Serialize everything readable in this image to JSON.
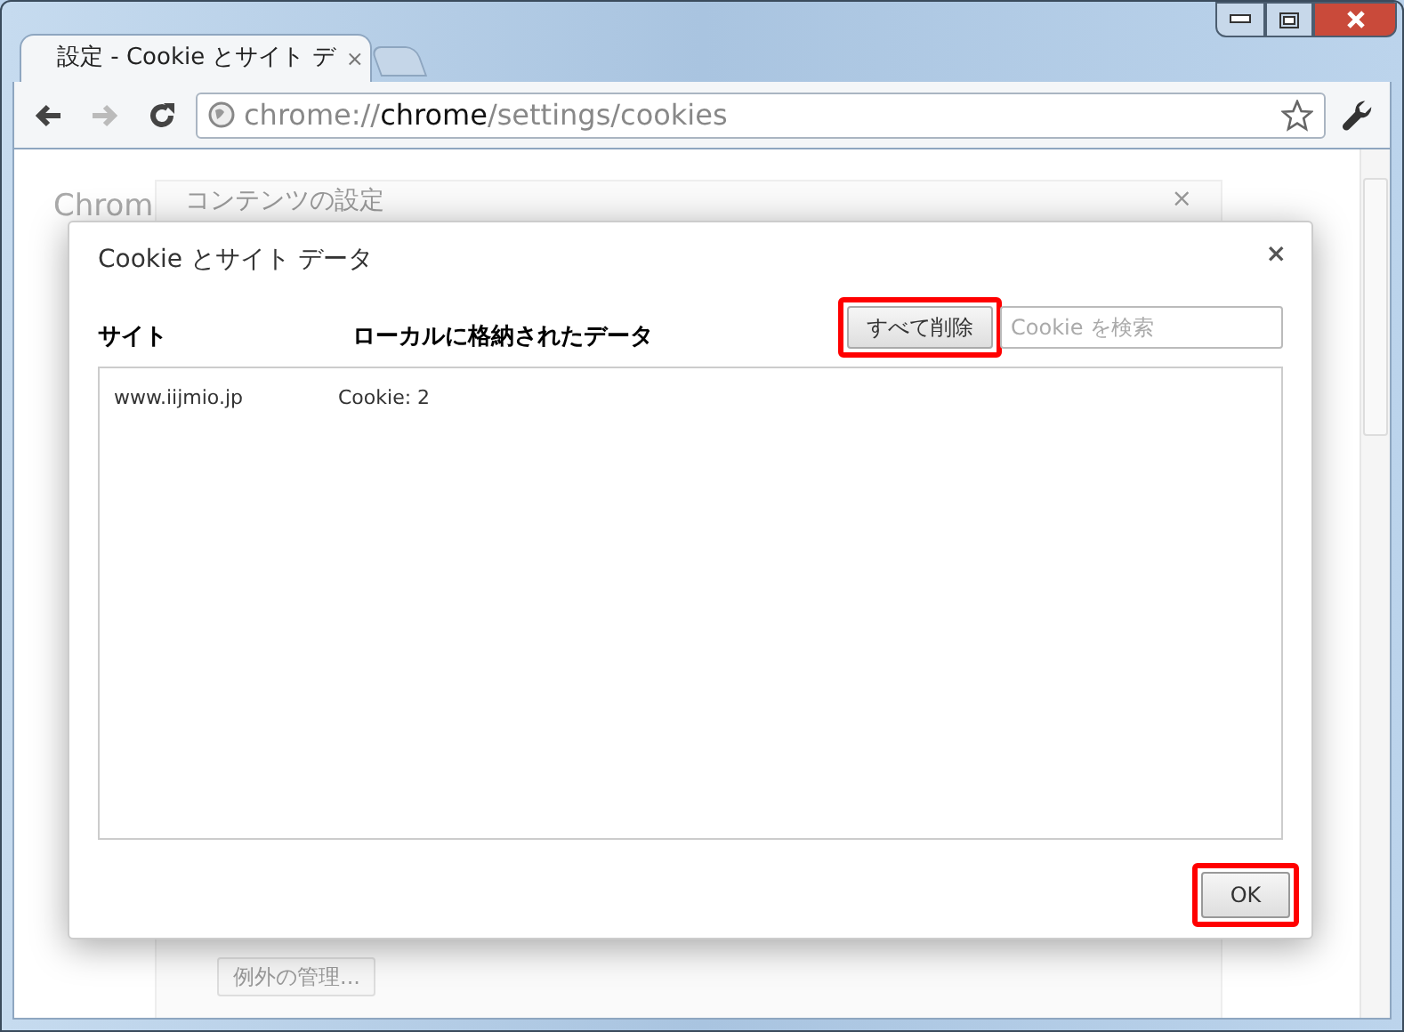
{
  "tabs": [
    {
      "title": "設定 - Cookie とサイト デ",
      "selected": true,
      "close": "×"
    }
  ],
  "toolbar": {
    "url_scheme": "chrome://",
    "url_host": "chrome",
    "url_path": "/settings/cookies"
  },
  "background_page": {
    "heading": "Chrom",
    "panel_title": "コンテンツの設定",
    "panel_close": "×",
    "manage_exceptions_button": "例外の管理..."
  },
  "dialog": {
    "title": "Cookie とサイト データ",
    "close": "×",
    "columns": [
      "サイト",
      "ローカルに格納されたデータ"
    ],
    "remove_all_button": {
      "label": "すべて削除",
      "highlighted": true
    },
    "search": {
      "placeholder": "Cookie を検索"
    },
    "rows": [
      {
        "site": "www.iijmio.jp",
        "data": "Cookie: 2"
      }
    ],
    "ok_button": {
      "label": "OK",
      "highlighted": true
    }
  }
}
